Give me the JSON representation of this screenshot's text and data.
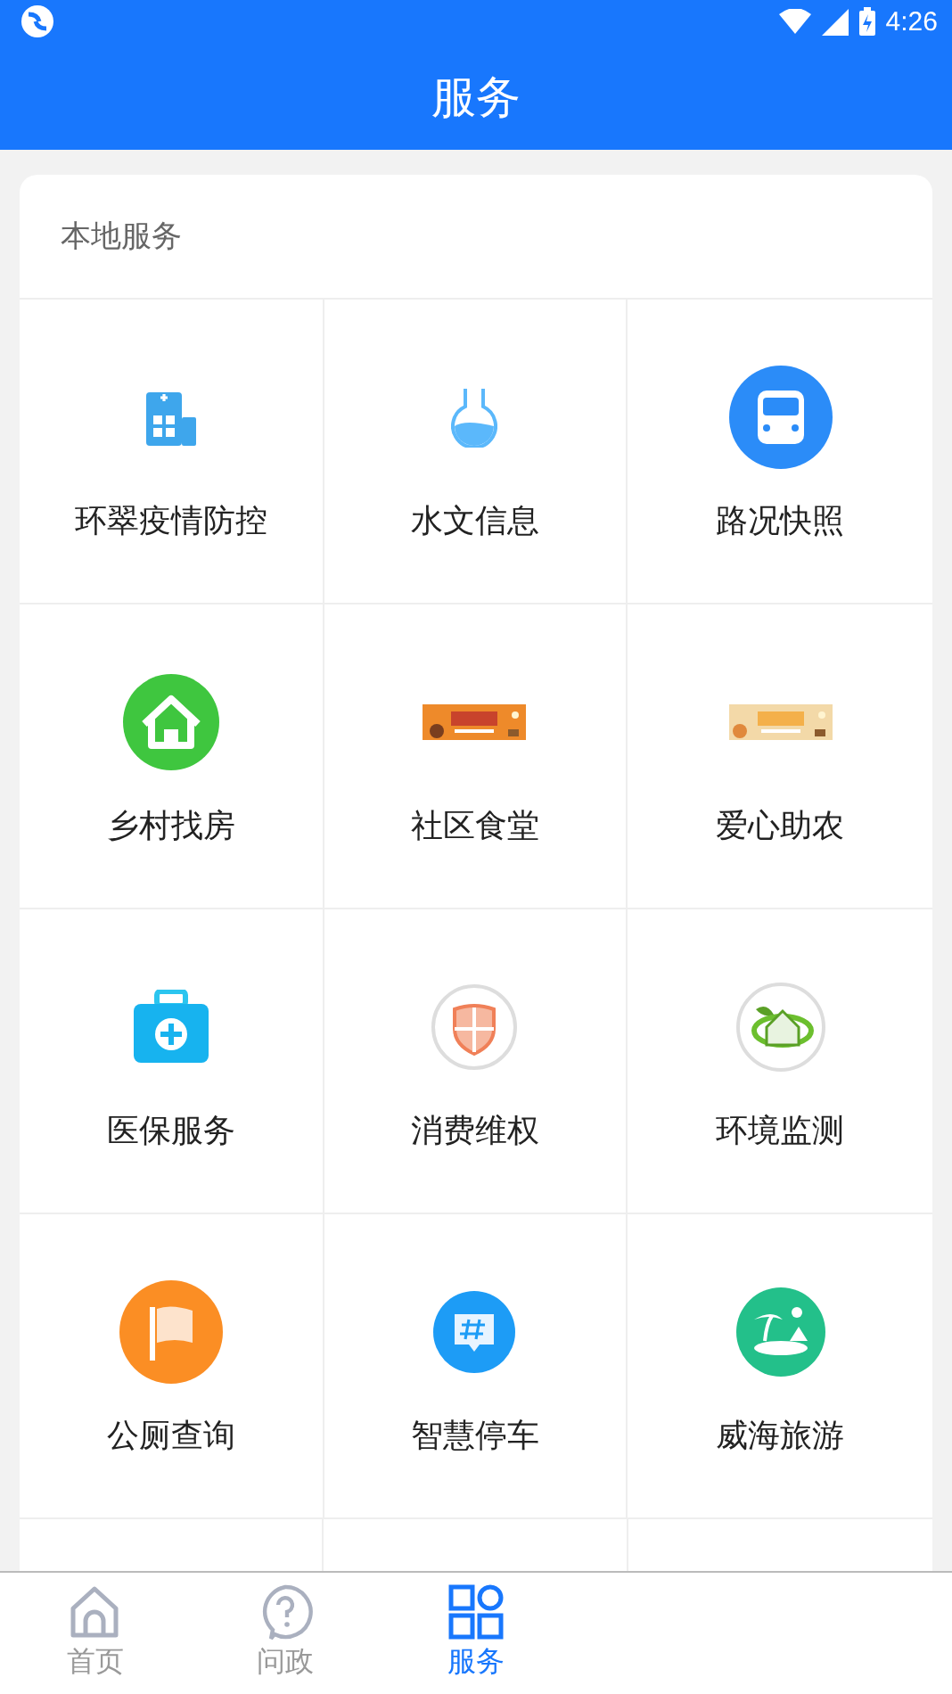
{
  "status_bar": {
    "time": "4:26"
  },
  "header": {
    "title": "服务"
  },
  "section": {
    "title": "本地服务",
    "items": [
      {
        "label": "环翠疫情防控",
        "kind": "icon"
      },
      {
        "label": "水文信息",
        "kind": "icon"
      },
      {
        "label": "路况快照",
        "kind": "icon"
      },
      {
        "label": "乡村找房",
        "kind": "icon"
      },
      {
        "label": "社区食堂",
        "kind": "picture"
      },
      {
        "label": "爱心助农",
        "kind": "picture"
      },
      {
        "label": "医保服务",
        "kind": "icon"
      },
      {
        "label": "消费维权",
        "kind": "icon"
      },
      {
        "label": "环境监测",
        "kind": "icon"
      },
      {
        "label": "公厕查询",
        "kind": "icon"
      },
      {
        "label": "智慧停车",
        "kind": "icon"
      },
      {
        "label": "威海旅游",
        "kind": "icon"
      }
    ]
  },
  "bottom_nav": [
    {
      "label": "首页",
      "selected": false
    },
    {
      "label": "问政",
      "selected": false
    },
    {
      "label": "服务",
      "selected": true
    }
  ]
}
